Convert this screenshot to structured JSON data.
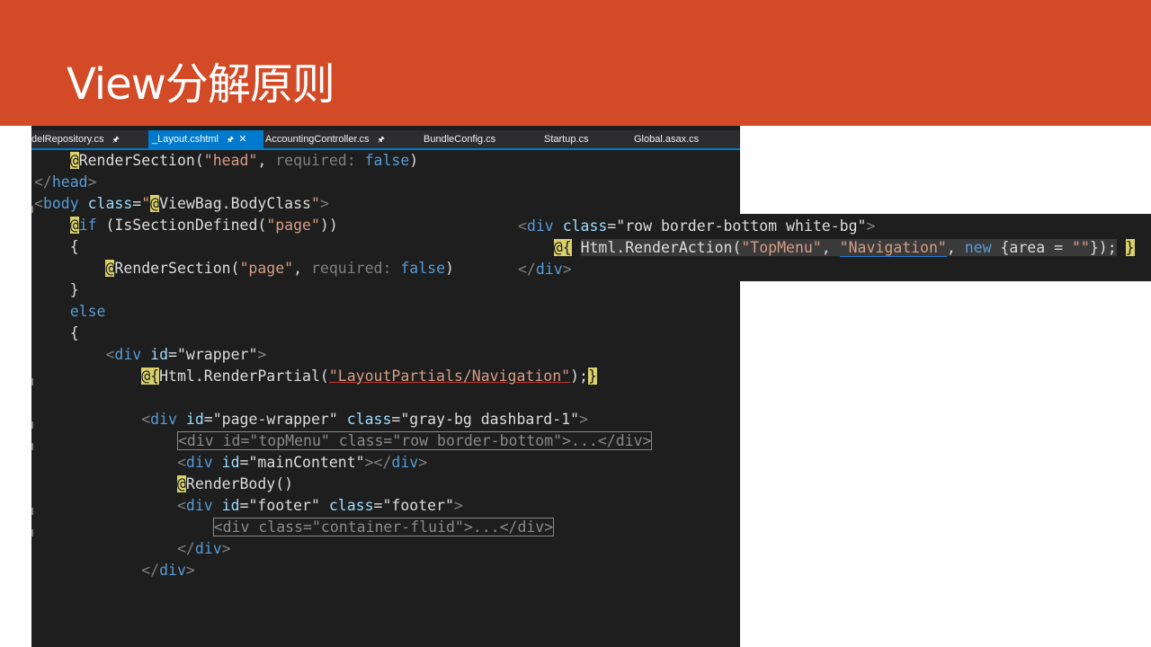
{
  "slide": {
    "title": "View分解原则"
  },
  "tabs": [
    {
      "label": "delRepository.cs",
      "pin": "🖈"
    },
    {
      "label": "_Layout.cshtml",
      "pin": "🖈",
      "close": "✕",
      "active": true
    },
    {
      "label": "AccountingController.cs",
      "pin": "🖈"
    },
    {
      "label": "BundleConfig.cs"
    },
    {
      "label": "Startup.cs"
    },
    {
      "label": "Global.asax.cs"
    }
  ],
  "code": {
    "l1": {
      "at": "@",
      "fn": "RenderSection(",
      "s1": "\"head\"",
      "c1": ", ",
      "p": "required:",
      "sp": " ",
      "kw": "false",
      "close": ")"
    },
    "l2": {
      "t1": "</",
      "tn": "head",
      "t2": ">"
    },
    "l3": {
      "t1": "<",
      "tn": "body",
      "sp": " ",
      "an": "class",
      "eq": "=",
      "q1": "\"",
      "at": "@",
      "rest": "ViewBag.BodyClass",
      "q2": "\"",
      "t2": ">"
    },
    "l4": {
      "at": "@",
      "kw": "if",
      "rest": " (IsSectionDefined(",
      "s1": "\"page\"",
      "close": "))"
    },
    "l5": {
      "brace": "{"
    },
    "l6": {
      "at": "@",
      "fn": "RenderSection(",
      "s1": "\"page\"",
      "c1": ", ",
      "p": "required:",
      "sp": " ",
      "kw": "false",
      "close": ")"
    },
    "l7": {
      "brace": "}"
    },
    "l8": {
      "kw": "else"
    },
    "l9": {
      "brace": "{"
    },
    "l10": {
      "t1": "<",
      "tn": "div",
      "sp": " ",
      "an": "id",
      "eq": "=",
      "val": "\"wrapper\"",
      "t2": ">"
    },
    "l11": {
      "at": "@{",
      "fn": "Html.RenderPartial(",
      "s1": "\"LayoutPartials/Navigation\"",
      "close": ");",
      "end": "}"
    },
    "l13": {
      "t1": "<",
      "tn": "div",
      "sp": " ",
      "an": "id",
      "eq": "=",
      "v1": "\"page-wrapper\"",
      "sp2": " ",
      "an2": "class",
      "eq2": "=",
      "v2": "\"gray-bg dashbard-1\"",
      "t2": ">"
    },
    "l14": {
      "text": "<div id=\"topMenu\" class=\"row border-bottom\">...</div>"
    },
    "l15": {
      "t1": "<",
      "tn": "div",
      "sp": " ",
      "an": "id",
      "eq": "=",
      "val": "\"mainContent\"",
      "t2": "></",
      "tn2": "div",
      "t3": ">"
    },
    "l16": {
      "at": "@",
      "fn": "RenderBody()"
    },
    "l17": {
      "t1": "<",
      "tn": "div",
      "sp": " ",
      "an": "id",
      "eq": "=",
      "v1": "\"footer\"",
      "sp2": " ",
      "an2": "class",
      "eq2": "=",
      "v2": "\"footer\"",
      "t2": ">"
    },
    "l18": {
      "text": "<div class=\"container-fluid\">...</div>"
    },
    "l19": {
      "t1": "</",
      "tn": "div",
      "t2": ">"
    },
    "l20": {
      "t1": "</",
      "tn": "div",
      "t2": ">"
    }
  },
  "inset": {
    "l1": {
      "t1": "<",
      "tn": "div",
      "sp": " ",
      "an": "class",
      "eq": "=",
      "val": "\"row border-bottom white-bg\"",
      "t2": ">"
    },
    "l2": {
      "at": "@{",
      "sp": " ",
      "fn": "Html.RenderAction(",
      "s1": "\"TopMenu\"",
      "c1": ", ",
      "s2": "\"Navigation\"",
      "c2": ", ",
      "kw": "new",
      "rest": " {area = ",
      "s3": "\"\"",
      "close": "});",
      "sp2": " ",
      "end": "}"
    },
    "l3": {
      "t1": "</",
      "tn": "div",
      "t2": ">"
    }
  },
  "colors": {
    "title_bar": "#d34a26",
    "editor_bg": "#1e1e1e",
    "tab_active": "#007acc"
  }
}
